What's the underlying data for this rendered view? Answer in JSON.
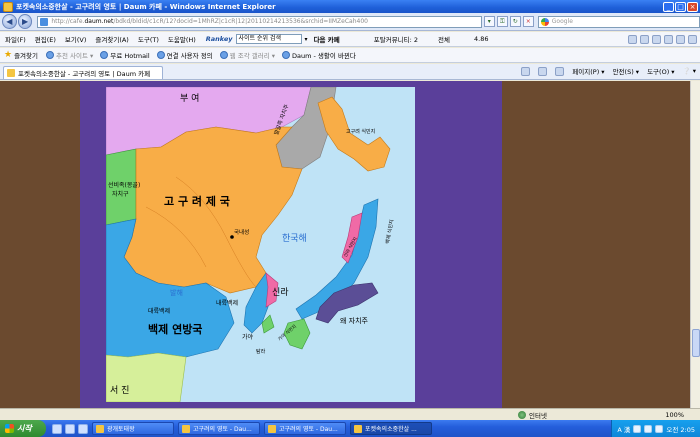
{
  "window": {
    "title": "포켓속의소중한살 - 고구려의 영토 | Daum 카페 - Windows Internet Explorer",
    "controls": [
      "_",
      "□",
      "×"
    ]
  },
  "address": {
    "url_prefix": "http://cafe.",
    "url_domain": "daum.net",
    "url_rest": "/bdkd/bldid/c1cR/12?docid=1MhRZ|c1cR|12|20110214213536&srchid=IIMZeCah400",
    "search_placeholder": "Google"
  },
  "menu": {
    "items": [
      "파일(F)",
      "편집(E)",
      "보기(V)",
      "즐겨찾기(A)",
      "도구(T)",
      "도움말(H)"
    ],
    "rankey_logo": "Rankey",
    "rankey_input": "사이트 순위 검색",
    "rankey_go": "▾",
    "daum": "다음 카페",
    "portal": "포탈커뮤니티: 2",
    "all": "전체",
    "rating": "4.86"
  },
  "favorites": {
    "label": "즐겨찾기",
    "items": [
      {
        "label": "추천 사이트 ▾",
        "dim": true
      },
      {
        "label": "무료 Hotmail",
        "dim": false
      },
      {
        "label": "연결 사용자 정의",
        "dim": false
      },
      {
        "label": "웹 조각 갤러리 ▾",
        "dim": true
      },
      {
        "label": "Daum - 생활이 바뀐다",
        "dim": false
      }
    ]
  },
  "tabs": {
    "active": "포켓속의소중한살 - 고구려의 영토 | Daum 카페",
    "commands": [
      "페이지(P) ▾",
      "안전(S) ▾",
      "도구(O) ▾",
      "❔ ▾"
    ]
  },
  "map": {
    "labels": {
      "buyeo": "부 여",
      "goguryeo": "고 구 려  제 국",
      "sunbi": "선비족(몽골)\n자치구",
      "gungnaeseong": "국내성",
      "hanguk_sea": "한국해",
      "baekje_federation": "백제 연방국",
      "daeryuk_baekje": "대륙백제",
      "balhae": "발해",
      "naeryuk_baekje": "내륙백제",
      "silla": "신라",
      "gaya": "가야",
      "yamato": "왜 자치주",
      "goguryeo_sikmin": "고구려 식민지",
      "seojin": "서 진",
      "mangal": "말갈족 자치주",
      "silla_colony": "신라 식민지",
      "baekje_colony": "백제 식민지",
      "gaya_colony": "가야 식민지",
      "tamna": "탐라"
    }
  },
  "status": {
    "zone": "인터넷",
    "zoom": "100%"
  },
  "taskbar": {
    "start": "시작",
    "tasks": [
      "광개토태왕",
      "고구려의 영토 - Dau...",
      "고구려의 영토 - Dau...",
      "포켓속의소중한살 ..."
    ],
    "tray_ime": "A 漢",
    "clock": "오전 2:05"
  }
}
